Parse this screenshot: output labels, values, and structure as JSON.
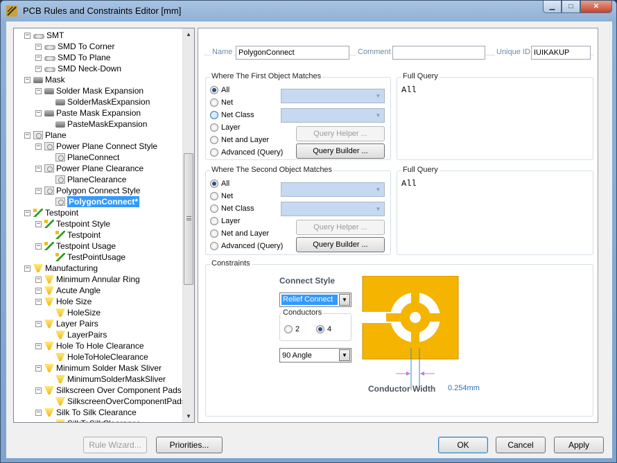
{
  "window": {
    "title": "PCB Rules and Constraints Editor [mm]"
  },
  "tree": {
    "items": [
      {
        "label": "SMT",
        "level": 0,
        "icon": "smt-icon"
      },
      {
        "label": "SMD To Corner",
        "level": 1,
        "icon": "smt-icon"
      },
      {
        "label": "SMD To Plane",
        "level": 1,
        "icon": "smt-icon"
      },
      {
        "label": "SMD Neck-Down",
        "level": 1,
        "icon": "smt-icon"
      },
      {
        "label": "Mask",
        "level": 0,
        "icon": "mask-icon"
      },
      {
        "label": "Solder Mask Expansion",
        "level": 1,
        "icon": "mask-icon"
      },
      {
        "label": "SolderMaskExpansion",
        "level": 2,
        "icon": "mask-icon"
      },
      {
        "label": "Paste Mask Expansion",
        "level": 1,
        "icon": "mask-icon"
      },
      {
        "label": "PasteMaskExpansion",
        "level": 2,
        "icon": "mask-icon"
      },
      {
        "label": "Plane",
        "level": 0,
        "icon": "plane-icon"
      },
      {
        "label": "Power Plane Connect Style",
        "level": 1,
        "icon": "plane-icon"
      },
      {
        "label": "PlaneConnect",
        "level": 2,
        "icon": "plane-icon"
      },
      {
        "label": "Power Plane Clearance",
        "level": 1,
        "icon": "plane-icon"
      },
      {
        "label": "PlaneClearance",
        "level": 2,
        "icon": "plane-icon"
      },
      {
        "label": "Polygon Connect Style",
        "level": 1,
        "icon": "plane-icon"
      },
      {
        "label": "PolygonConnect*",
        "level": 2,
        "icon": "plane-icon",
        "selected": true
      },
      {
        "label": "Testpoint",
        "level": 0,
        "icon": "testpoint-icon"
      },
      {
        "label": "Testpoint Style",
        "level": 1,
        "icon": "testpoint-icon"
      },
      {
        "label": "Testpoint",
        "level": 2,
        "icon": "testpoint-icon"
      },
      {
        "label": "Testpoint Usage",
        "level": 1,
        "icon": "testpoint-icon"
      },
      {
        "label": "TestPointUsage",
        "level": 2,
        "icon": "testpoint-icon"
      },
      {
        "label": "Manufacturing",
        "level": 0,
        "icon": "manufacturing-icon"
      },
      {
        "label": "Minimum Annular Ring",
        "level": 1,
        "icon": "manufacturing-icon"
      },
      {
        "label": "Acute Angle",
        "level": 1,
        "icon": "manufacturing-icon"
      },
      {
        "label": "Hole Size",
        "level": 1,
        "icon": "manufacturing-icon"
      },
      {
        "label": "HoleSize",
        "level": 2,
        "icon": "manufacturing-icon"
      },
      {
        "label": "Layer Pairs",
        "level": 1,
        "icon": "manufacturing-icon"
      },
      {
        "label": "LayerPairs",
        "level": 2,
        "icon": "manufacturing-icon"
      },
      {
        "label": "Hole To Hole Clearance",
        "level": 1,
        "icon": "manufacturing-icon"
      },
      {
        "label": "HoleToHoleClearance",
        "level": 2,
        "icon": "manufacturing-icon"
      },
      {
        "label": "Minimum Solder Mask Sliver",
        "level": 1,
        "icon": "manufacturing-icon"
      },
      {
        "label": "MinimumSolderMaskSliver",
        "level": 2,
        "icon": "manufacturing-icon"
      },
      {
        "label": "Silkscreen Over Component Pads",
        "level": 1,
        "icon": "manufacturing-icon"
      },
      {
        "label": "SilkscreenOverComponentPads",
        "level": 2,
        "icon": "manufacturing-icon"
      },
      {
        "label": "Silk To Silk Clearance",
        "level": 1,
        "icon": "manufacturing-icon"
      },
      {
        "label": "SilkToSilkClearance",
        "level": 2,
        "icon": "manufacturing-icon"
      }
    ]
  },
  "rule": {
    "name_label": "Name",
    "name_value": "PolygonConnect",
    "comment_label": "Comment",
    "comment_value": "",
    "uid_label": "Unique ID",
    "uid_value": "IUIKAKUP"
  },
  "first": {
    "title": "Where The First Object Matches",
    "options": [
      "All",
      "Net",
      "Net Class",
      "Layer",
      "Net and Layer",
      "Advanced (Query)"
    ],
    "selected": "All",
    "query_helper": "Query Helper ...",
    "query_builder": "Query Builder ...",
    "full_query_title": "Full Query",
    "full_query": "All"
  },
  "second": {
    "title": "Where The Second Object Matches",
    "options": [
      "All",
      "Net",
      "Net Class",
      "Layer",
      "Net and Layer",
      "Advanced (Query)"
    ],
    "selected": "All",
    "query_helper": "Query Helper ...",
    "query_builder": "Query Builder ...",
    "full_query_title": "Full Query",
    "full_query": "All"
  },
  "constraints": {
    "title": "Constraints",
    "connect_style_label": "Connect Style",
    "connect_style_value": "Relief Connect",
    "conductors_label": "Conductors",
    "conductor_options": [
      "2",
      "4"
    ],
    "conductors_selected": "4",
    "angle_value": "90 Angle",
    "conductor_width_label": "Conductor Width",
    "conductor_width_value": "0.254mm",
    "colors": {
      "copper": "#f5b400",
      "dimension": "#2b8fd6",
      "arrow": "#c27bd6"
    }
  },
  "footer": {
    "rule_wizard": "Rule Wizard...",
    "priorities": "Priorities...",
    "ok": "OK",
    "cancel": "Cancel",
    "apply": "Apply"
  }
}
